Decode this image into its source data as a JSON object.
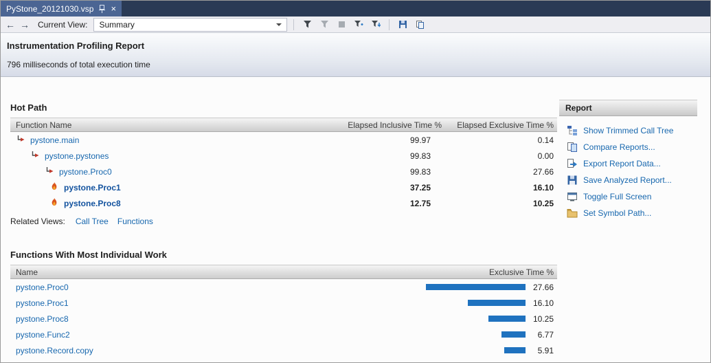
{
  "window": {
    "tab_title": "PyStone_20121030.vsp",
    "close_glyph": "×"
  },
  "toolbar": {
    "back_glyph": "←",
    "forward_glyph": "→",
    "current_view_label": "Current View:",
    "view_value": "Summary"
  },
  "report_header": {
    "title": "Instrumentation Profiling Report",
    "subtitle": "796 milliseconds of total execution time"
  },
  "hot_path": {
    "title": "Hot Path",
    "columns": {
      "name": "Function Name",
      "inclusive": "Elapsed Inclusive Time %",
      "exclusive": "Elapsed Exclusive Time %"
    },
    "rows": [
      {
        "name": "pystone.main",
        "inclusive": "99.97",
        "exclusive": "0.14",
        "indent": 0,
        "icon": "hot-path-branch-icon",
        "hot": false
      },
      {
        "name": "pystone.pystones",
        "inclusive": "99.83",
        "exclusive": "0.00",
        "indent": 1,
        "icon": "hot-path-branch-icon",
        "hot": false
      },
      {
        "name": "pystone.Proc0",
        "inclusive": "99.83",
        "exclusive": "27.66",
        "indent": 2,
        "icon": "hot-path-branch-icon",
        "hot": false
      },
      {
        "name": "pystone.Proc1",
        "inclusive": "37.25",
        "exclusive": "16.10",
        "indent": 3,
        "icon": "flame-icon",
        "hot": true
      },
      {
        "name": "pystone.Proc8",
        "inclusive": "12.75",
        "exclusive": "10.25",
        "indent": 3,
        "icon": "flame-icon",
        "hot": true
      }
    ],
    "related_views_label": "Related Views:",
    "related_links": [
      "Call Tree",
      "Functions"
    ]
  },
  "functions_most_work": {
    "title": "Functions With Most Individual Work",
    "columns": {
      "name": "Name",
      "exclusive": "Exclusive Time %"
    },
    "bar_scale": 5.25,
    "bar_color": "#1f72bf",
    "rows": [
      {
        "name": "pystone.Proc0",
        "value": "27.66"
      },
      {
        "name": "pystone.Proc1",
        "value": "16.10"
      },
      {
        "name": "pystone.Proc8",
        "value": "10.25"
      },
      {
        "name": "pystone.Func2",
        "value": "6.77"
      },
      {
        "name": "pystone.Record.copy",
        "value": "5.91"
      }
    ]
  },
  "report_panel": {
    "title": "Report",
    "items": [
      {
        "label": "Show Trimmed Call Tree",
        "icon": "trimmed-call-tree-icon"
      },
      {
        "label": "Compare Reports...",
        "icon": "compare-reports-icon"
      },
      {
        "label": "Export Report Data...",
        "icon": "export-data-icon"
      },
      {
        "label": "Save Analyzed Report...",
        "icon": "save-report-icon"
      },
      {
        "label": "Toggle Full Screen",
        "icon": "full-screen-icon"
      },
      {
        "label": "Set Symbol Path...",
        "icon": "symbol-path-icon"
      }
    ]
  }
}
